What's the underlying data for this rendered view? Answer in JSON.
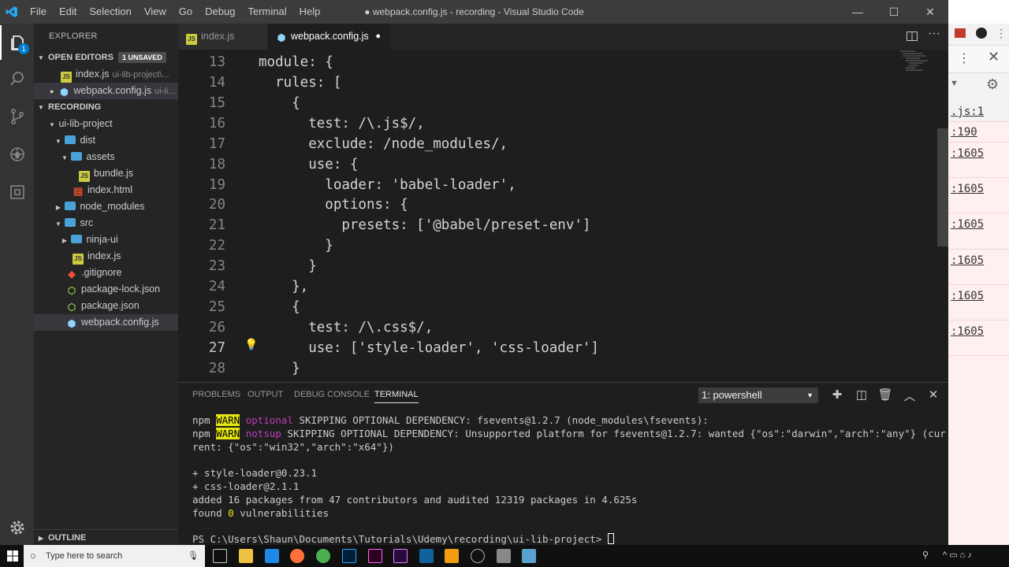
{
  "window": {
    "title": "● webpack.config.js - recording - Visual Studio Code",
    "menu": [
      "File",
      "Edit",
      "Selection",
      "View",
      "Go",
      "Debug",
      "Terminal",
      "Help"
    ],
    "controls": [
      "—",
      "☐",
      "✕"
    ]
  },
  "activity": {
    "explorer_badge": "1"
  },
  "sidebar": {
    "title": "EXPLORER",
    "open_editors": {
      "label": "OPEN EDITORS",
      "badge": "1 UNSAVED"
    },
    "open_files": [
      {
        "name": "index.js",
        "path": "ui-lib-project\\..."
      },
      {
        "name": "webpack.config.js",
        "path": "ui-li..."
      }
    ],
    "recording_label": "RECORDING",
    "tree": [
      "ui-lib-project",
      "dist",
      "assets",
      "bundle.js",
      "index.html",
      "node_modules",
      "src",
      "ninja-ui",
      "index.js",
      ".gitignore",
      "package-lock.json",
      "package.json",
      "webpack.config.js"
    ],
    "outline_label": "OUTLINE"
  },
  "tabs": [
    {
      "label": "index.js"
    },
    {
      "label": "webpack.config.js",
      "dirty": "●"
    }
  ],
  "editor": {
    "line_numbers": [
      "13",
      "14",
      "15",
      "16",
      "17",
      "18",
      "19",
      "20",
      "21",
      "22",
      "23",
      "24",
      "25",
      "26",
      "27",
      "28"
    ],
    "lines": [
      "module: {",
      "  rules: [",
      "    {",
      "      test: /\\.js$/,",
      "      exclude: /node_modules/,",
      "      use: {",
      "        loader: 'babel-loader',",
      "        options: {",
      "          presets: ['@babel/preset-env']",
      "        }",
      "      }",
      "    },",
      "    {",
      "      test: /\\.css$/,",
      "      use: ['style-loader', 'css-loader']",
      "    }"
    ]
  },
  "panel": {
    "tabs": [
      "PROBLEMS",
      "OUTPUT",
      "DEBUG CONSOLE",
      "TERMINAL"
    ],
    "terminal_select": "1: powershell",
    "terminal": {
      "npm": "npm",
      "warn": "WARN",
      "optional": "optional",
      "line1_rest": " SKIPPING OPTIONAL DEPENDENCY: fsevents@1.2.7 (node_modules\\fsevents):",
      "notsup": "notsup",
      "line2_rest": " SKIPPING OPTIONAL DEPENDENCY: Unsupported platform for fsevents@1.2.7: wanted {\"os\":\"darwin\",\"arch\":\"any\"} (cur",
      "line3": "rent: {\"os\":\"win32\",\"arch\":\"x64\"})",
      "line5": "+ style-loader@0.23.1",
      "line6": "+ css-loader@2.1.1",
      "line7": "added 16 packages from 47 contributors and audited 12319 packages in 4.625s",
      "line8_a": "found ",
      "line8_b": "0",
      "line8_c": " vulnerabilities",
      "prompt": "PS C:\\Users\\Shaun\\Documents\\Tutorials\\Udemy\\recording\\ui-lib-project> "
    }
  },
  "browser": {
    "links": [
      ".js:1",
      ":190",
      ":1605",
      ":1605",
      ":1605",
      ":1605",
      ":1605",
      ":1605"
    ]
  },
  "taskbar": {
    "search_placeholder": "Type here to search"
  },
  "colors": {
    "activity": "#333333",
    "sidebar": "#252526",
    "editor": "#1e1e1e",
    "selection": "#37373d"
  }
}
